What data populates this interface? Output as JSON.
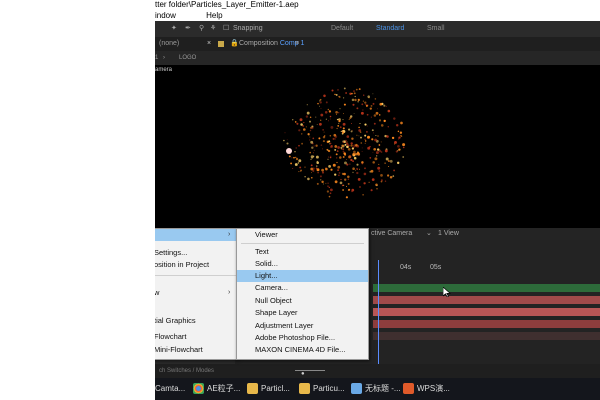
{
  "window": {
    "title": "tter folder\\Particles_Layer_Emitter-1.aep"
  },
  "menubar": [
    "indow",
    "Help"
  ],
  "toolbar": {
    "snapping_label": "Snapping",
    "workspaces": [
      "Default",
      "Standard",
      "Small"
    ],
    "active_workspace": "Standard"
  },
  "panel": {
    "left_tab": "(none)",
    "comp_tab_prefix": "Composition",
    "comp_tab_name": "Comp 1",
    "breadcrumb_num": "1",
    "breadcrumb_logo": "LOGO",
    "viewer_label": "amera"
  },
  "viewer_bar": {
    "camera": "ctive Camera",
    "views": "1 View"
  },
  "timeline": {
    "ruler": [
      "04s",
      "05s"
    ],
    "status": "ch Switches / Modes"
  },
  "context_menu": {
    "items": [
      "Settings...",
      "osition in Project",
      "w",
      "tial Graphics",
      "Flowchart",
      "Mini-Flowchart"
    ]
  },
  "submenu": {
    "items": [
      "Viewer",
      "Text",
      "Solid...",
      "Light...",
      "Camera...",
      "Null Object",
      "Shape Layer",
      "Adjustment Layer",
      "Adobe Photoshop File...",
      "MAXON CINEMA 4D File..."
    ],
    "highlighted": "Light..."
  },
  "taskbar": {
    "items": [
      {
        "label": "Camta...",
        "icon": "camtasia-icon"
      },
      {
        "label": "AE粒子...",
        "icon": "chrome-icon"
      },
      {
        "label": "Particl...",
        "icon": "folder-icon"
      },
      {
        "label": "Particu...",
        "icon": "folder-icon"
      },
      {
        "label": "无标题 -...",
        "icon": "notepad-icon"
      },
      {
        "label": "WPS演...",
        "icon": "wps-icon"
      }
    ]
  },
  "colors": {
    "highlight": "#99c9f0",
    "accent": "#5a8cff",
    "particle": "#ff8a1e"
  }
}
